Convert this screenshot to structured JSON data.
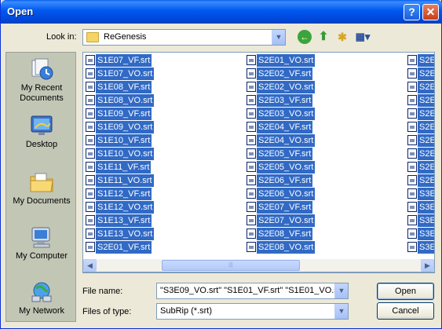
{
  "window": {
    "title": "Open"
  },
  "toolbar": {
    "look_in_label": "Look in:",
    "look_in_value": "ReGenesis"
  },
  "places": [
    {
      "label": "My Recent Documents",
      "icon": "recent-documents-icon"
    },
    {
      "label": "Desktop",
      "icon": "desktop-icon"
    },
    {
      "label": "My Documents",
      "icon": "my-documents-icon"
    },
    {
      "label": "My Computer",
      "icon": "my-computer-icon"
    },
    {
      "label": "My Network",
      "icon": "my-network-icon"
    }
  ],
  "files": {
    "col1": [
      "S1E07_VF.srt",
      "S1E07_VO.srt",
      "S1E08_VF.srt",
      "S1E08_VO.srt",
      "S1E09_VF.srt",
      "S1E09_VO.srt",
      "S1E10_VF.srt",
      "S1E10_VO.srt",
      "S1E11_VF.srt",
      "S1E11_VO.srt",
      "S1E12_VF.srt",
      "S1E12_VO.srt",
      "S1E13_VF.srt",
      "S1E13_VO.srt",
      "S2E01_VF.srt"
    ],
    "col2": [
      "S2E01_VO.srt",
      "S2E02_VF.srt",
      "S2E02_VO.srt",
      "S2E03_VF.srt",
      "S2E03_VO.srt",
      "S2E04_VF.srt",
      "S2E04_VO.srt",
      "S2E05_VF.srt",
      "S2E05_VO.srt",
      "S2E06_VF.srt",
      "S2E06_VO.srt",
      "S2E07_VF.srt",
      "S2E07_VO.srt",
      "S2E08_VF.srt",
      "S2E08_VO.srt"
    ],
    "col3": [
      "S2E",
      "S2E",
      "S2E",
      "S2E",
      "S2E",
      "S2E",
      "S2E",
      "S2E",
      "S2E",
      "S2E",
      "S3E",
      "S3E",
      "S3E",
      "S3E",
      "S3E"
    ]
  },
  "footer": {
    "file_name_label": "File name:",
    "file_name_value": "\"S3E09_VO.srt\" \"S1E01_VF.srt\" \"S1E01_VO.s",
    "file_type_label": "Files of type:",
    "file_type_value": "SubRip (*.srt)",
    "open_label": "Open",
    "cancel_label": "Cancel"
  },
  "colors": {
    "selection": "#316ac5",
    "titlebar": "#0058ee",
    "face": "#ece9d8"
  }
}
